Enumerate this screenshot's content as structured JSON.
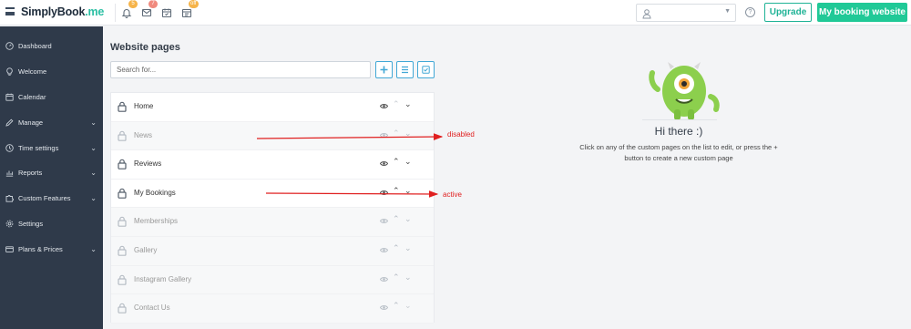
{
  "app": {
    "logo_text": "implyBook",
    "logo_dot": ".me",
    "logo_initial": "S"
  },
  "topbar": {
    "notifications_badge": "5",
    "messages_badge": "7",
    "calendar_badge": "",
    "tasks_badge": "off",
    "upgrade_label": "Upgrade",
    "my_website_label": "My booking website",
    "help_glyph": "?"
  },
  "sidebar": {
    "items": [
      {
        "label": "Dashboard",
        "icon": "dashboard-icon",
        "has_children": false
      },
      {
        "label": "Welcome",
        "icon": "lightbulb-icon",
        "has_children": false
      },
      {
        "label": "Calendar",
        "icon": "calendar-icon",
        "has_children": false
      },
      {
        "label": "Manage",
        "icon": "pencil-icon",
        "has_children": true
      },
      {
        "label": "Time settings",
        "icon": "clock-icon",
        "has_children": true
      },
      {
        "label": "Reports",
        "icon": "bar-chart-icon",
        "has_children": true
      },
      {
        "label": "Custom Features",
        "icon": "puzzle-icon",
        "has_children": true
      },
      {
        "label": "Settings",
        "icon": "gear-icon",
        "has_children": false
      },
      {
        "label": "Plans & Prices",
        "icon": "credit-card-icon",
        "has_children": true
      }
    ]
  },
  "main": {
    "title": "Website pages",
    "search_placeholder": "Search for...",
    "pages": [
      {
        "label": "Home",
        "state": "enabled",
        "can_move_up": false,
        "can_move_down": true
      },
      {
        "label": "News",
        "state": "disabled",
        "can_move_up": false,
        "can_move_down": true
      },
      {
        "label": "Reviews",
        "state": "enabled",
        "can_move_up": true,
        "can_move_down": true
      },
      {
        "label": "My Bookings",
        "state": "active",
        "can_move_up": true,
        "can_move_down": true
      },
      {
        "label": "Memberships",
        "state": "disabled",
        "can_move_up": true,
        "can_move_down": true
      },
      {
        "label": "Gallery",
        "state": "disabled",
        "can_move_up": true,
        "can_move_down": true
      },
      {
        "label": "Instagram Gallery",
        "state": "disabled",
        "can_move_up": true,
        "can_move_down": true
      },
      {
        "label": "Contact Us",
        "state": "disabled",
        "can_move_up": true,
        "can_move_down": false
      }
    ]
  },
  "annotations": {
    "disabled_label": "disabled",
    "active_label": "active",
    "color": "#e02020"
  },
  "empty_state": {
    "heading": "Hi there :)",
    "text": "Click on any of the custom pages on the list to edit, or press the + button to create a new custom page"
  },
  "colors": {
    "sidebar_bg": "#2f3a4a",
    "accent_green": "#20c997",
    "accent_blue": "#42a8d6",
    "monster_green": "#8ccf4d"
  }
}
